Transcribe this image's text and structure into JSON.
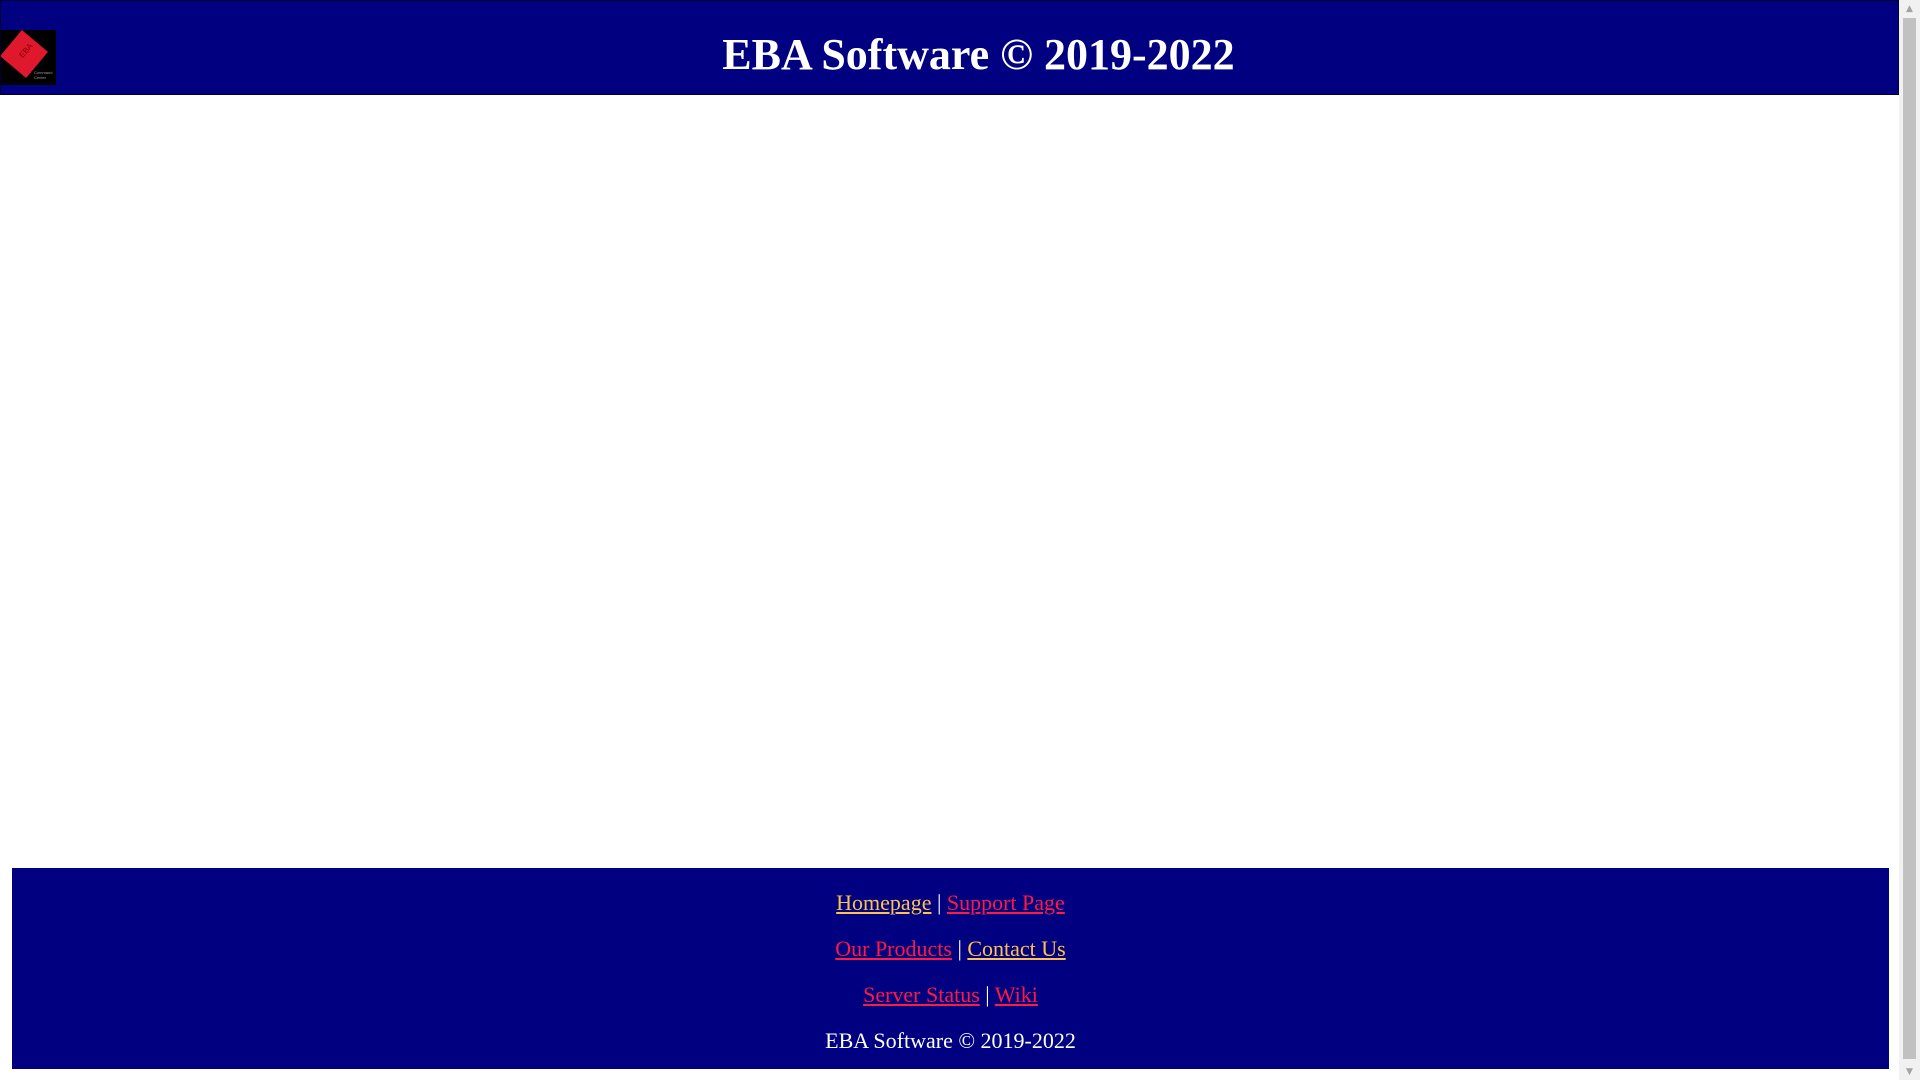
{
  "header": {
    "title": "EBA Software © 2019-2022",
    "logo": {
      "text": "EBA",
      "subtext": "Command\nCenter",
      "icon": "eba-logo"
    }
  },
  "footer": {
    "row1": {
      "link1": "Homepage",
      "separator": "|",
      "link2": "Support Page"
    },
    "row2": {
      "link1": "Our Products",
      "separator": "|",
      "link2": "Contact Us"
    },
    "row3": {
      "link1": "Server Status",
      "separator": "|",
      "link2": "Wiki"
    },
    "copyright": "EBA Software © 2019-2022"
  },
  "colors": {
    "navy": "#000080",
    "link_yellow": "#ffc24d",
    "link_red": "#ff1a40",
    "white": "#ffffff"
  },
  "scrollbar": {
    "up_icon": "chevron-up-icon",
    "down_icon": "chevron-down-icon"
  }
}
